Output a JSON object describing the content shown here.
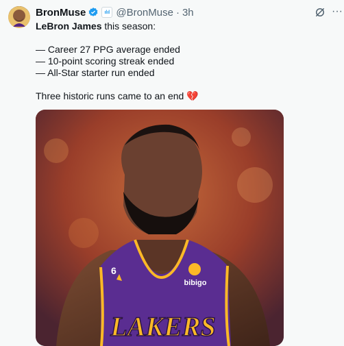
{
  "post": {
    "author_name": "BronMuse",
    "handle": "@BronMuse",
    "separator": "·",
    "time": "3h",
    "affiliate_label": "ılıl",
    "more_label": "···",
    "text": {
      "lead_bold": "LeBron James",
      "lead_rest": " this season:",
      "items": [
        "— Career 27 PPG average ended",
        "— 10-point scoring streak ended",
        "— All-Star starter run ended"
      ],
      "closing": "Three historic runs came to an end",
      "emoji": "💔"
    },
    "image": {
      "jersey_team": "LAKERS",
      "jersey_number": "6",
      "sponsor": "bibigo"
    }
  },
  "colors": {
    "verified_blue": "#1d9bf0",
    "jersey_purple": "#5a2d91",
    "jersey_gold": "#fdb927"
  }
}
